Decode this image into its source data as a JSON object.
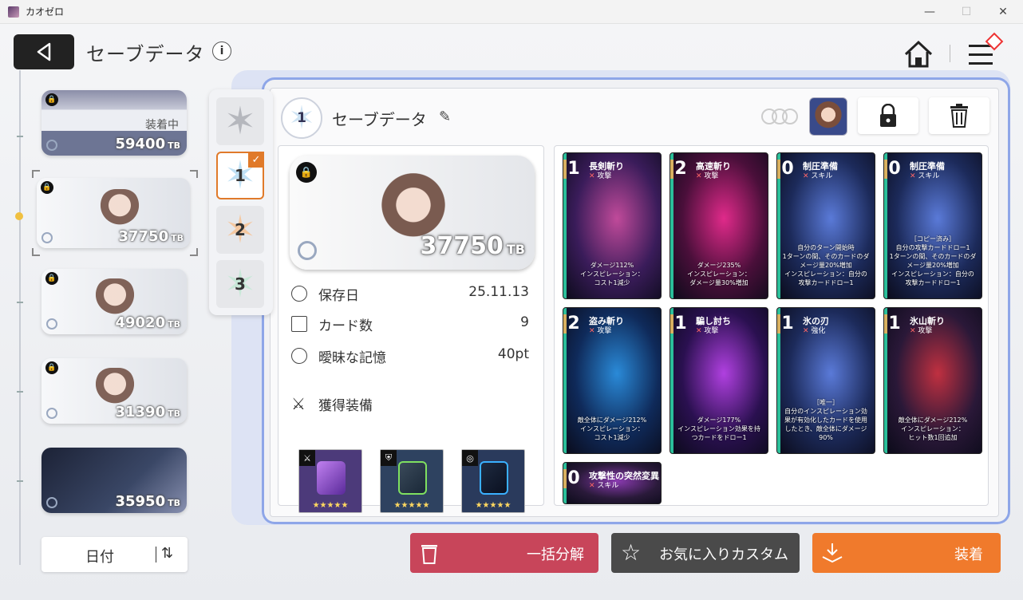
{
  "window": {
    "title": "カオゼロ",
    "minimize": "—",
    "maximize": "☐",
    "close": "✕"
  },
  "header": {
    "title": "セーブデータ",
    "info_glyph": "i"
  },
  "slots": [
    {
      "label": "装着中",
      "tb": "59400",
      "unit": "TB"
    },
    {
      "tb": "37750",
      "unit": "TB"
    },
    {
      "tb": "49020",
      "unit": "TB"
    },
    {
      "tb": "31390",
      "unit": "TB"
    },
    {
      "tb": "35950",
      "unit": "TB"
    }
  ],
  "sort": {
    "label": "日付"
  },
  "deck_tabs": [
    "1",
    "2",
    "3"
  ],
  "deck": {
    "number": "1",
    "title": "セーブデータ",
    "preview": {
      "tb": "37750",
      "unit": "TB"
    },
    "stats": [
      {
        "label": "保存日",
        "value": "25.11.13"
      },
      {
        "label": "カード数",
        "value": "9"
      },
      {
        "label": "曖昧な記憶",
        "value": "40pt"
      }
    ],
    "equipment_label": "獲得装備",
    "equipment": [
      {
        "stars": "★★★★★",
        "color": "#8a4fc8"
      },
      {
        "stars": "★★★★★",
        "color": "#3b4a60"
      },
      {
        "stars": "★★★★★",
        "color": "#2a3a58"
      }
    ]
  },
  "cards": [
    {
      "cost": "1",
      "name": "長剣斬り",
      "type": "攻撃",
      "desc": "ダメージ112%\nインスピレーション：\nコスト1減少",
      "bg": "#3a1c5a",
      "accent": "#c04a9a",
      "side": "#2bbf9a"
    },
    {
      "cost": "2",
      "name": "高速斬り",
      "type": "攻撃",
      "desc": "ダメージ235%\nインスピレーション：\nダメージ量30%増加",
      "bg": "#4a0f3a",
      "accent": "#e02a8a",
      "side": "#2bbf9a"
    },
    {
      "cost": "0",
      "name": "制圧準備",
      "type": "スキル",
      "desc": "自分のターン開始時\n1ターンの間、そのカードのダメージ量20%増加\nインスピレーション：自分の攻撃カードドロー1",
      "bg": "#1c2a5a",
      "accent": "#5a7ad8",
      "side": "#2bbf9a"
    },
    {
      "cost": "0",
      "name": "制圧準備",
      "type": "スキル",
      "desc": "［コピー済み］\n自分の攻撃カードドロー1\n1ターンの間、そのカードのダメージ量20%増加\nインスピレーション：自分の攻撃カードドロー1",
      "bg": "#1c2a5a",
      "accent": "#5a7ad8",
      "side": "#2bbf9a"
    },
    {
      "cost": "2",
      "name": "盗み斬り",
      "type": "攻撃",
      "desc": "敵全体にダメージ212%\nインスピレーション：\nコスト1減少",
      "bg": "#0f2a5a",
      "accent": "#2a8ad8",
      "side": "#2bbf9a"
    },
    {
      "cost": "1",
      "name": "騙し討ち",
      "type": "攻撃",
      "desc": "ダメージ177%\nインスピレーション効果を持つカードをドロー1",
      "bg": "#2a1050",
      "accent": "#b040e0",
      "side": "#2bbf9a"
    },
    {
      "cost": "1",
      "name": "氷の刃",
      "type": "強化",
      "desc": "［唯一］\n自分のインスピレーション効果が有効化したカードを使用したとき、敵全体にダメージ90%",
      "bg": "#1c2a5a",
      "accent": "#5a7ad8",
      "side": "#2bbf9a"
    },
    {
      "cost": "1",
      "name": "氷山斬り",
      "type": "攻撃",
      "desc": "敵全体にダメージ212%\nインスピレーション：\nヒット数1回追加",
      "bg": "#2a1838",
      "accent": "#c03040",
      "side": "#2bbf9a"
    },
    {
      "cost": "0",
      "name": "攻撃性の突然変異",
      "type": "スキル",
      "desc": "",
      "bg": "#2a1a3a",
      "accent": "#8a3ab0",
      "side": "#2bbf9a"
    }
  ],
  "actions": {
    "disassemble": "一括分解",
    "favorite": "お気に入りカスタム",
    "equip": "装着"
  },
  "colors": {
    "disassemble": "#c8455a",
    "favorite": "#4a4a4a",
    "equip": "#f07a2c"
  }
}
